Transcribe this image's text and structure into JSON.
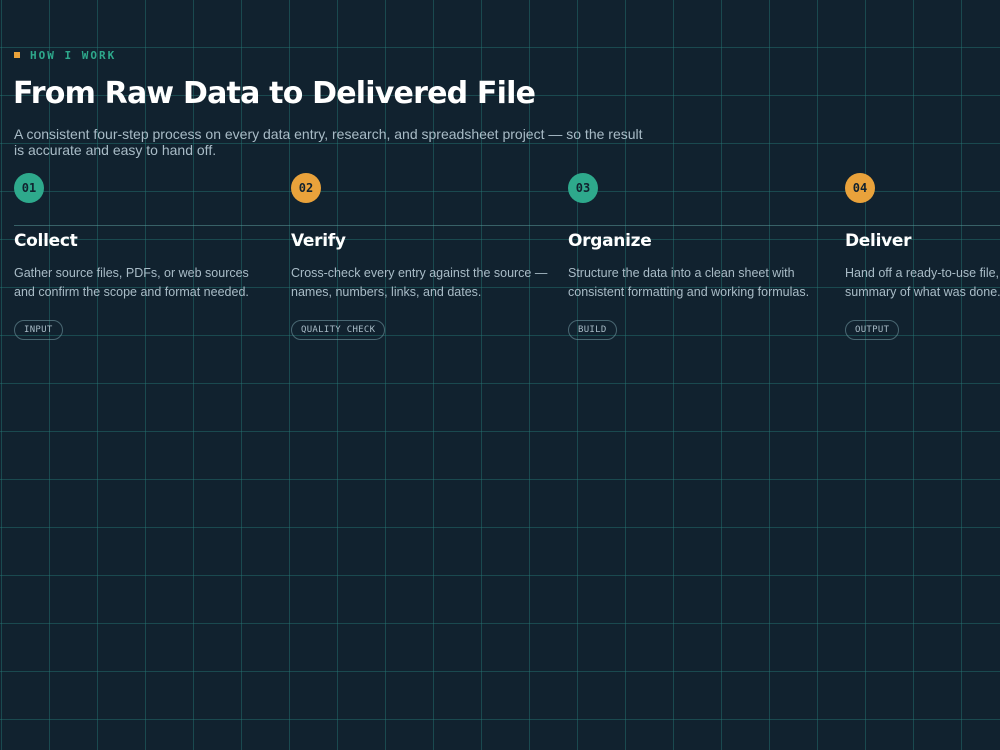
{
  "section": {
    "eyebrow": "HOW I WORK",
    "title": "From Raw Data to Delivered File",
    "subtitle": "A consistent four-step process on every data entry, research, and spreadsheet project — so the result is accurate and easy to hand off."
  },
  "steps": [
    {
      "number": "01",
      "title": "Collect",
      "desc_line1": "Gather source files, PDFs, or web sources",
      "desc_line2": "and confirm the scope and format needed.",
      "tag": "INPUT",
      "badge_color": "#2ea98c"
    },
    {
      "number": "02",
      "title": "Verify",
      "desc_line1": "Cross-check every entry against the source —",
      "desc_line2": "names, numbers, links, and dates.",
      "tag": "QUALITY CHECK",
      "badge_color": "#e9a23b"
    },
    {
      "number": "03",
      "title": "Organize",
      "desc_line1": "Structure the data into a clean sheet with",
      "desc_line2": "consistent formatting and working formulas.",
      "tag": "BUILD",
      "badge_color": "#2ea98c"
    },
    {
      "number": "04",
      "title": "Deliver",
      "desc_line1": "Hand off a ready-to-use file, w",
      "desc_line2": "summary of what was done.",
      "tag": "OUTPUT",
      "badge_color": "#e9a23b"
    }
  ],
  "colors": {
    "background": "#11222f",
    "accent_teal": "#2ea98c",
    "accent_amber": "#e9a23b",
    "text_muted": "#a9bcc7"
  }
}
